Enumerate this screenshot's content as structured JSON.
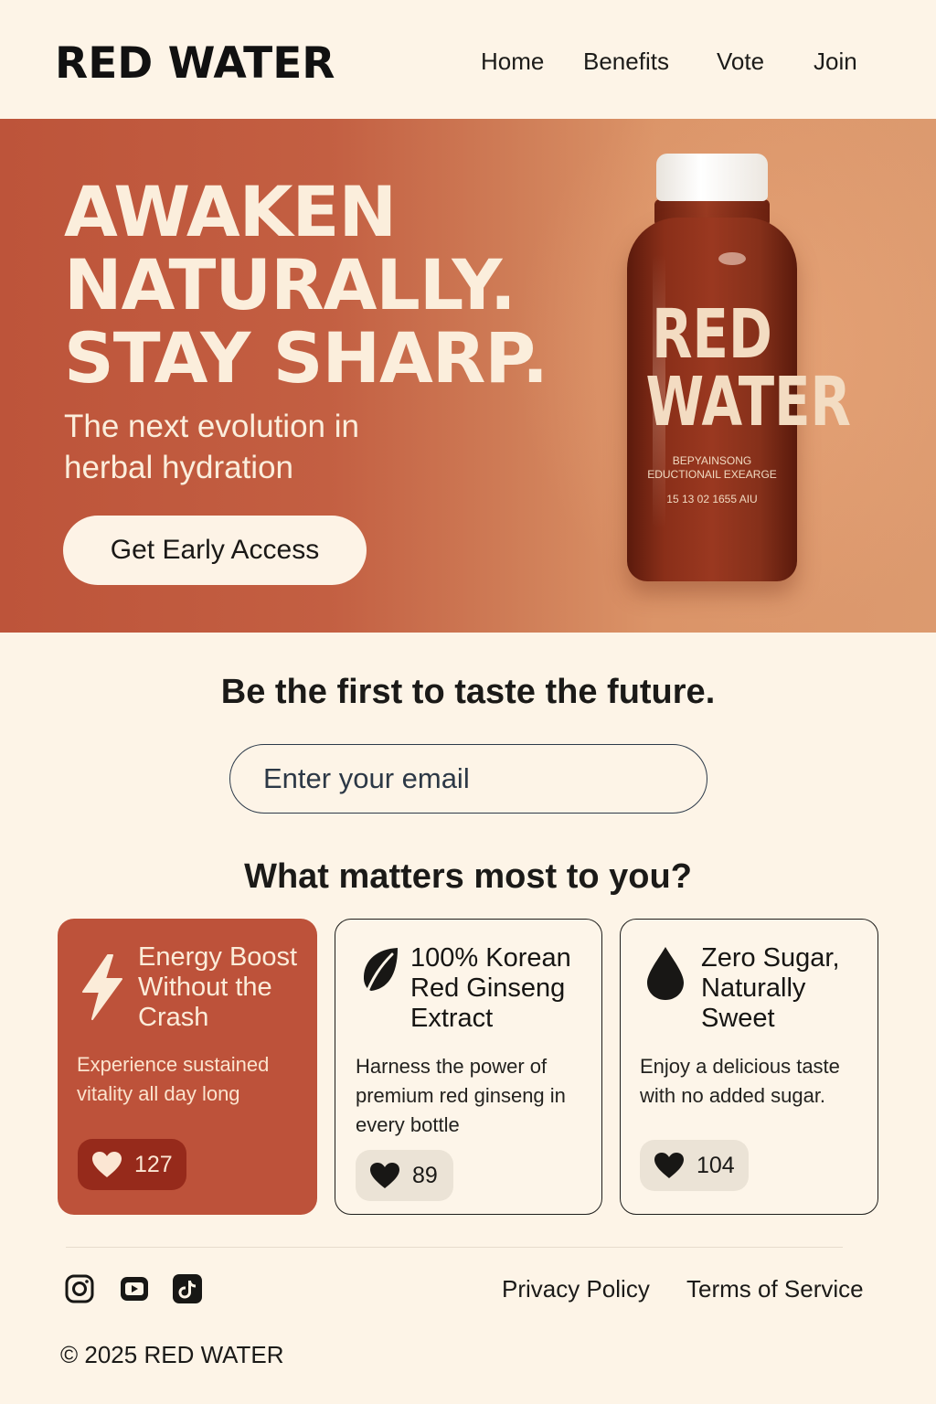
{
  "brand": {
    "name": "RED WATER"
  },
  "nav": {
    "items": [
      "Home",
      "Benefits",
      "Vote",
      "Join"
    ]
  },
  "hero": {
    "headline": [
      "AWAKEN",
      "NATURALLY.",
      "STAY SHARP."
    ],
    "subhead": "The next evolution in herbal hydration",
    "cta_label": "Get Early Access",
    "bottle_label": {
      "line1": "RED",
      "line2": "WATER",
      "small1": "BEPYAINSONG",
      "small2": "EDUCTIONAIL EXEARGE",
      "small3": "15 13 02 1655 AIU"
    }
  },
  "signup": {
    "tagline": "Be the first to taste the future.",
    "email_placeholder": "Enter your email"
  },
  "vote_section": {
    "question": "What matters most to you?",
    "cards": [
      {
        "icon": "lightning-icon",
        "title": "Energy Boost Without the Crash",
        "desc": "Experience sustained vitality all day long",
        "votes": "127",
        "selected": true
      },
      {
        "icon": "leaf-icon",
        "title": "100% Korean Red Ginseng Extract",
        "desc": "Harness the power of premium red ginseng in every bottle",
        "votes": "89",
        "selected": false
      },
      {
        "icon": "droplet-icon",
        "title": "Zero Sugar, Naturally Sweet",
        "desc": "Enjoy a delicious taste with no added sugar.",
        "votes": "104",
        "selected": false
      }
    ]
  },
  "footer": {
    "social": [
      "instagram-icon",
      "youtube-icon",
      "tiktok-icon"
    ],
    "links": [
      "Privacy Policy",
      "Terms of Service"
    ],
    "copyright": "© 2025 RED WATER"
  },
  "colors": {
    "background": "#fdf4e7",
    "accent": "#bd523a",
    "accent_dark": "#962a1b",
    "text": "#161513"
  }
}
